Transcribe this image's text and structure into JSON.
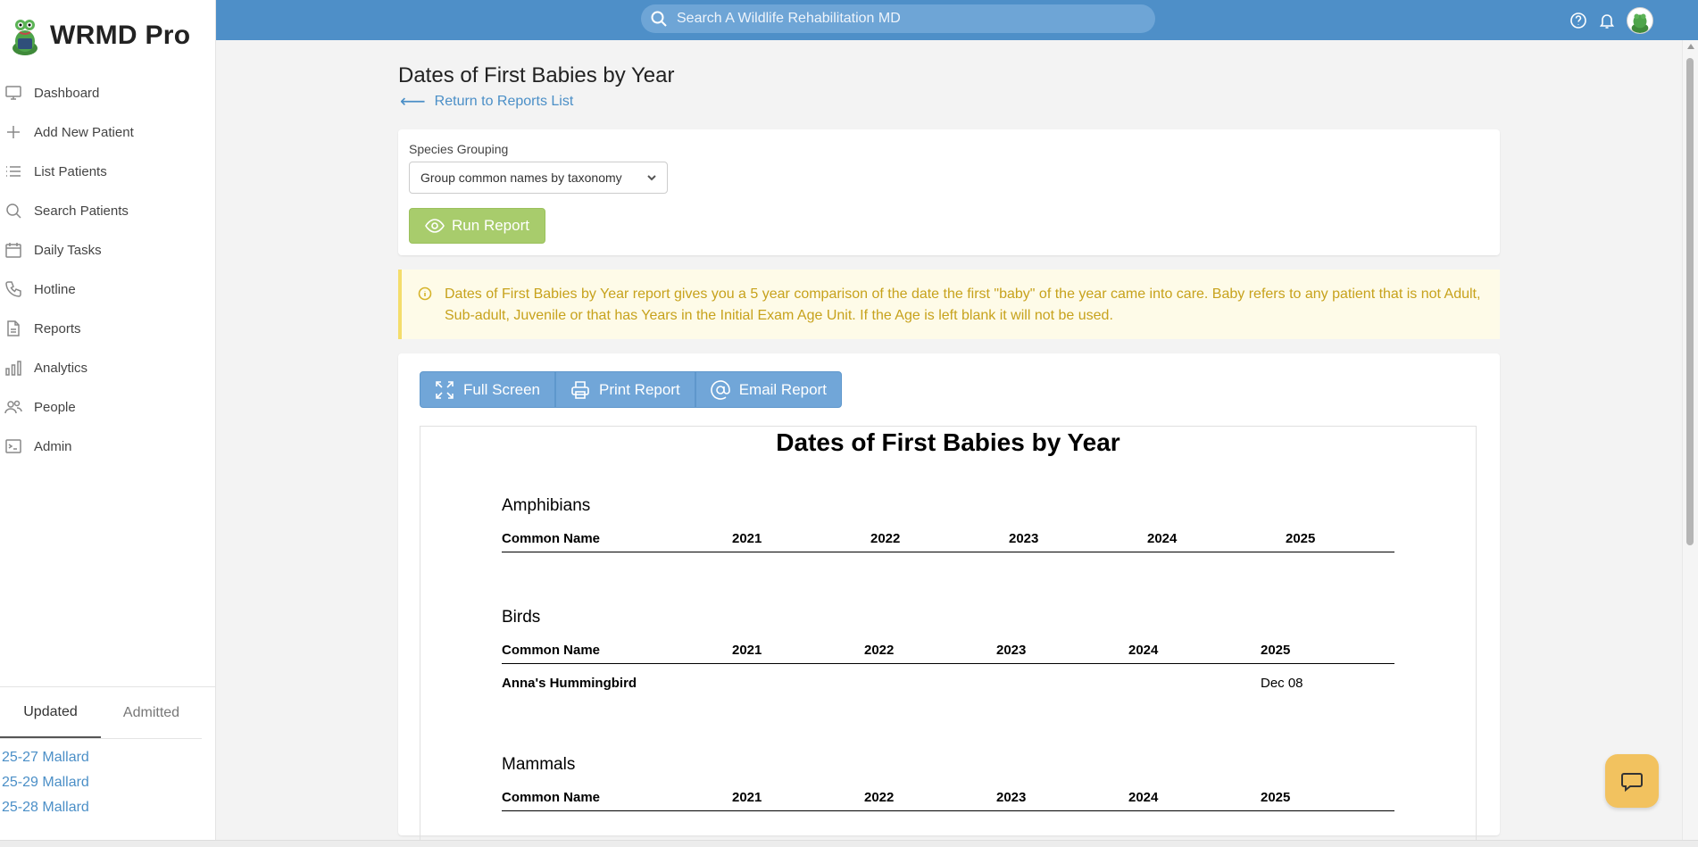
{
  "app": {
    "name": "WRMD Pro"
  },
  "search": {
    "placeholder": "Search A Wildlife Rehabilitation MD"
  },
  "sidebar": {
    "items": [
      {
        "label": "Dashboard",
        "icon": "monitor-icon"
      },
      {
        "label": "Add New Patient",
        "icon": "plus-icon"
      },
      {
        "label": "List Patients",
        "icon": "list-icon"
      },
      {
        "label": "Search Patients",
        "icon": "search-icon"
      },
      {
        "label": "Daily Tasks",
        "icon": "calendar-icon"
      },
      {
        "label": "Hotline",
        "icon": "phone-icon"
      },
      {
        "label": "Reports",
        "icon": "document-icon"
      },
      {
        "label": "Analytics",
        "icon": "bar-chart-icon"
      },
      {
        "label": "People",
        "icon": "users-icon"
      },
      {
        "label": "Admin",
        "icon": "terminal-icon"
      }
    ]
  },
  "recent": {
    "tabs": [
      "Updated",
      "Admitted"
    ],
    "active_tab": "Updated",
    "items": [
      "25-27 Mallard",
      "25-29 Mallard",
      "25-28 Mallard"
    ]
  },
  "page": {
    "title": "Dates of First Babies by Year",
    "back_link": "Return to Reports List"
  },
  "filter": {
    "label": "Species Grouping",
    "selected": "Group common names by taxonomy",
    "run_button": "Run Report"
  },
  "alert": {
    "text": "Dates of First Babies by Year report gives you a 5 year comparison of the date the first \"baby\" of the year came into care. Baby refers to any patient that is not Adult, Sub-adult, Juvenile or that has Years in the Initial Exam Age Unit. If the Age is left blank it will not be used."
  },
  "toolbar": {
    "full_screen": "Full Screen",
    "print": "Print Report",
    "email": "Email Report"
  },
  "report": {
    "title": "Dates of First Babies by Year",
    "groups": [
      {
        "name": "Amphibians",
        "headers": [
          "Common Name",
          "2021",
          "2022",
          "2023",
          "2024",
          "2025"
        ],
        "rows": []
      },
      {
        "name": "Birds",
        "headers": [
          "Common Name",
          "2021",
          "2022",
          "2023",
          "2024",
          "2025"
        ],
        "rows": [
          {
            "name": "Anna's Hummingbird",
            "values": [
              "",
              "",
              "",
              "",
              "Dec 08"
            ]
          }
        ]
      },
      {
        "name": "Mammals",
        "headers": [
          "Common Name",
          "2021",
          "2022",
          "2023",
          "2024",
          "2025"
        ],
        "rows": []
      }
    ]
  },
  "colors": {
    "topbar": "#4e8fc8",
    "link": "#4b8fc7",
    "run_button": "#a8cc6c",
    "alert_text": "#c7a21c",
    "help_bubble": "#f2c25f"
  }
}
